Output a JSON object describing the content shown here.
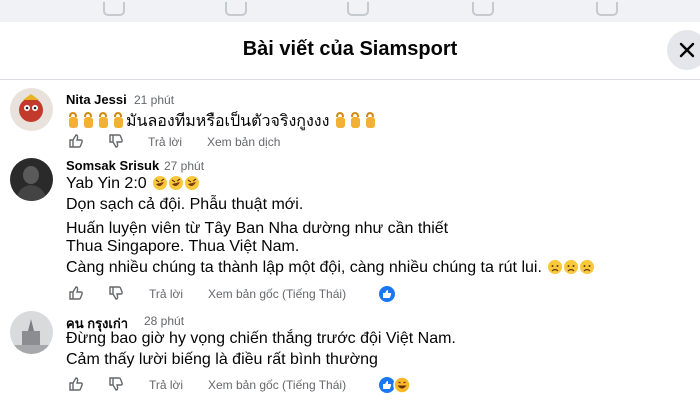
{
  "modal": {
    "title": "Bài viết của Siamsport"
  },
  "comments": [
    {
      "author": "Nita Jessi",
      "time": "21 phút",
      "lines": [
        "มันลองทีมหรือเป็นตัวจริงกูงงง"
      ],
      "actions": {
        "reply": "Trả lời",
        "see": "Xem bản dịch"
      }
    },
    {
      "author": "Somsak Srisuk",
      "time": "27 phút",
      "lines": [
        "Yab Yin 2:0",
        "Dọn sạch cả đội. Phẫu thuật mới.",
        "Huấn luyện viên từ Tây Ban Nha dường như cần thiết",
        "Thua Singapore. Thua Việt Nam.",
        "Càng nhiều chúng ta thành lập một đội, càng nhiều chúng ta rút lui."
      ],
      "actions": {
        "reply": "Trả lời",
        "see": "Xem bản gốc (Tiếng Thái)"
      }
    },
    {
      "author": "คน กรุงเก่า",
      "time": "28 phút",
      "lines": [
        "Đừng bao giờ hy vọng chiến thắng trước đội Việt Nam.",
        "Cảm thấy lười biếng là điều rất bình thường"
      ],
      "actions": {
        "reply": "Trả lời",
        "see": "Xem bản gốc (Tiếng Thái)"
      }
    }
  ],
  "colors": {
    "like_blue": "#1877f2",
    "haha_yellow": "#f7b928",
    "meta_gray": "#65676b"
  }
}
